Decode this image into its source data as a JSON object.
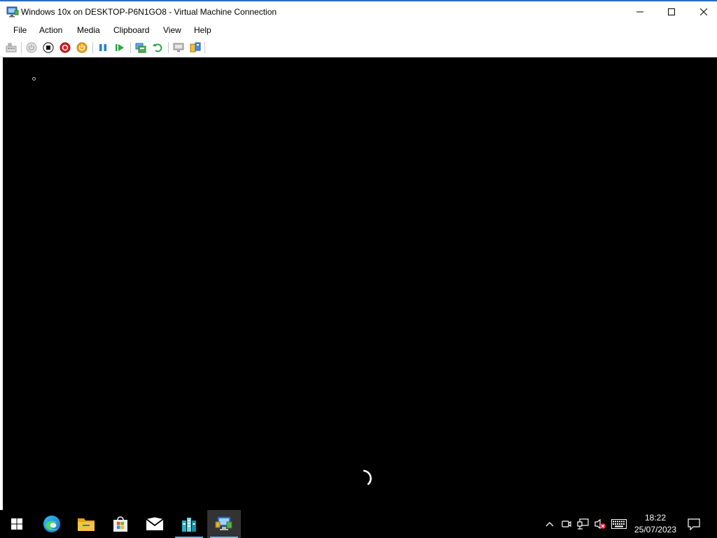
{
  "window": {
    "title": "Windows 10x on DESKTOP-P6N1GO8 - Virtual Machine Connection"
  },
  "menu": [
    {
      "label": "File"
    },
    {
      "label": "Action"
    },
    {
      "label": "Media"
    },
    {
      "label": "Clipboard"
    },
    {
      "label": "View"
    },
    {
      "label": "Help"
    }
  ],
  "toolbar": {
    "icons": [
      "ctrl-alt-del-icon",
      "start-icon",
      "turn-off-icon",
      "shutdown-icon",
      "save-icon",
      "pause-icon",
      "resume-icon",
      "checkpoint-icon",
      "revert-icon",
      "enhanced-session-icon",
      "share-icon"
    ]
  },
  "taskbar": {
    "apps": [
      "start-windows-icon",
      "edge-icon",
      "file-explorer-icon",
      "store-icon",
      "mail-icon",
      "hyperv-manager-icon",
      "vm-connection-icon"
    ],
    "active_app": "vm-connection-icon",
    "tray_icons": [
      "chevron-up-icon",
      "meet-now-icon",
      "network-icon",
      "volume-muted-icon",
      "keyboard-icon",
      "notification-icon"
    ],
    "time": "18:22",
    "date": "25/07/2023"
  },
  "colors": {
    "title_accent": "#2b6cc4",
    "screen_bg": "#000000",
    "taskbar_bg": "#000000"
  }
}
